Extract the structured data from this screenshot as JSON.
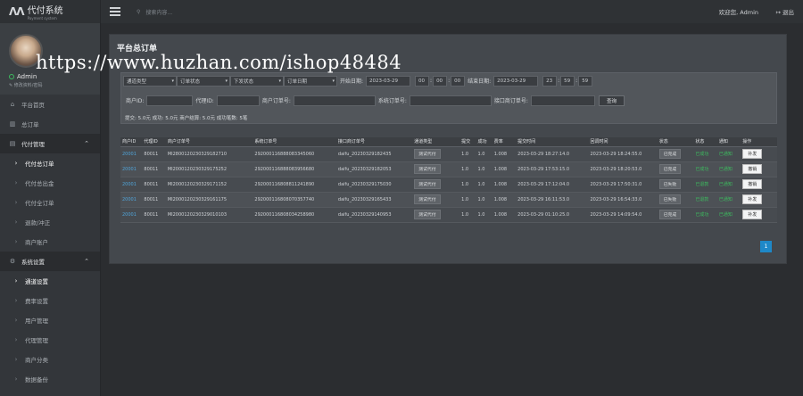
{
  "app": {
    "logo_mark": "ΛΛ",
    "logo_title": "代付系统",
    "logo_sub": "Payment system"
  },
  "user": {
    "name": "Admin",
    "edit_label": "✎ 修改资料/密码"
  },
  "sidebar": {
    "items": [
      {
        "label": "平台首页",
        "icon": "home-icon",
        "glyph": "⌂"
      },
      {
        "label": "总订单",
        "icon": "chart-icon",
        "glyph": "▥"
      },
      {
        "label": "代付管理",
        "icon": "list-icon",
        "glyph": "▤",
        "group": true
      },
      {
        "label": "代付总订单",
        "sub": true,
        "active": true
      },
      {
        "label": "代付总出金",
        "sub": true
      },
      {
        "label": "代付全订单",
        "sub": true
      },
      {
        "label": "退款/冲正",
        "sub": true
      },
      {
        "label": "商户账户",
        "sub": true
      },
      {
        "label": "系统设置",
        "icon": "gear-icon",
        "glyph": "⚙",
        "group": true
      },
      {
        "label": "通道设置",
        "sub": true,
        "active": true
      },
      {
        "label": "费率设置",
        "sub": true
      },
      {
        "label": "用户管理",
        "sub": true
      },
      {
        "label": "代理管理",
        "sub": true
      },
      {
        "label": "商户分类",
        "sub": true
      },
      {
        "label": "数据备份",
        "sub": true
      }
    ]
  },
  "topbar": {
    "search_placeholder": "搜索内容...",
    "welcome": "欢迎您, Admin",
    "logout": "退出"
  },
  "watermark": "https://www.huzhan.com/ishop48484",
  "panel": {
    "title": "平台总订单"
  },
  "filters": {
    "channel_type": "通道类型",
    "order_status": "订单状态",
    "issue_status": "下发状态",
    "order_date_type": "订单日期",
    "start_label": "开始日期:",
    "start_date": "2023-03-29",
    "start_h": "00",
    "start_m": "00",
    "start_s": "00",
    "end_label": "结束日期:",
    "end_date": "2023-03-29",
    "end_h": "23",
    "end_m": "59",
    "end_s": "59",
    "merchant_id_label": "商户ID:",
    "agent_id_label": "代理ID:",
    "merchant_order_label": "商户订单号:",
    "system_order_label": "系统订单号:",
    "upstream_order_label": "接口商订单号:",
    "search_button": "查询",
    "summary": "提交: 5.0元  成功: 5.0元  商户结算: 5.0元  成功笔数: 5笔"
  },
  "table": {
    "headers": [
      "商户ID",
      "代理ID",
      "商户订单号",
      "系统订单号",
      "接口商订单号",
      "通道类型",
      "提交",
      "成功",
      "费率",
      "提交时间",
      "回调时间",
      "状态",
      "状态",
      "通知",
      "操作"
    ],
    "rows": [
      {
        "mid": "20001",
        "aid": "80011",
        "morder": "MI280012023032918271​0",
        "sorder": "292000116888083345060",
        "uorder": "daifu_20230329182435",
        "type": "测试代付",
        "submit": "1.0",
        "success": "1.0",
        "rate": "1.008",
        "stime": "2023-03-29 18:27:14.0",
        "ctime": "2023-03-29 18:24:55.0",
        "status": "已完成",
        "s1": "已成功",
        "notify": "已通知",
        "op": "补发"
      },
      {
        "mid": "20001",
        "aid": "80011",
        "morder": "MI200012023032917525​2",
        "sorder": "292000116888083956680",
        "uorder": "daifu_20230329182053",
        "type": "测试代付",
        "submit": "1.0",
        "success": "1.0",
        "rate": "1.008",
        "stime": "2023-03-29 17:53:15.0",
        "ctime": "2023-03-29 18:20:53.0",
        "status": "已完成",
        "s1": "已成功",
        "notify": "已通知",
        "op": "撤销"
      },
      {
        "mid": "20001",
        "aid": "80011",
        "morder": "MI200012023032917115​2",
        "sorder": "292000116808811241890",
        "uorder": "daifu_20230329175030",
        "type": "测试代付",
        "submit": "1.0",
        "success": "1.0",
        "rate": "1.008",
        "stime": "2023-03-29 17:12:04.0",
        "ctime": "2023-03-29 17:50:31.0",
        "status": "已失败",
        "s1": "已退款",
        "notify": "已通知",
        "op": "撤销"
      },
      {
        "mid": "20001",
        "aid": "80011",
        "morder": "MI200012023032916117​5",
        "sorder": "292000116808070357740",
        "uorder": "daifu_20230329165433",
        "type": "测试代付",
        "submit": "1.0",
        "success": "1.0",
        "rate": "1.008",
        "stime": "2023-03-29 16:11:53.0",
        "ctime": "2023-03-29 16:54:33.0",
        "status": "已失败",
        "s1": "已退款",
        "notify": "已通知",
        "op": "补发"
      },
      {
        "mid": "20001",
        "aid": "80011",
        "morder": "MI200012023032901010​3",
        "sorder": "292000116808034258980",
        "uorder": "daifu_20230329140953",
        "type": "测试代付",
        "submit": "1.0",
        "success": "1.0",
        "rate": "1.008",
        "stime": "2023-03-29 01:10:25.0",
        "ctime": "2023-03-29 14:09:54.0",
        "status": "已完成",
        "s1": "已成功",
        "notify": "已通知",
        "op": "补发"
      }
    ]
  },
  "pager": {
    "page": "1"
  },
  "colors": {
    "accent": "#1e88c8",
    "success": "#3dbb5f",
    "link": "#4fa3d8"
  }
}
